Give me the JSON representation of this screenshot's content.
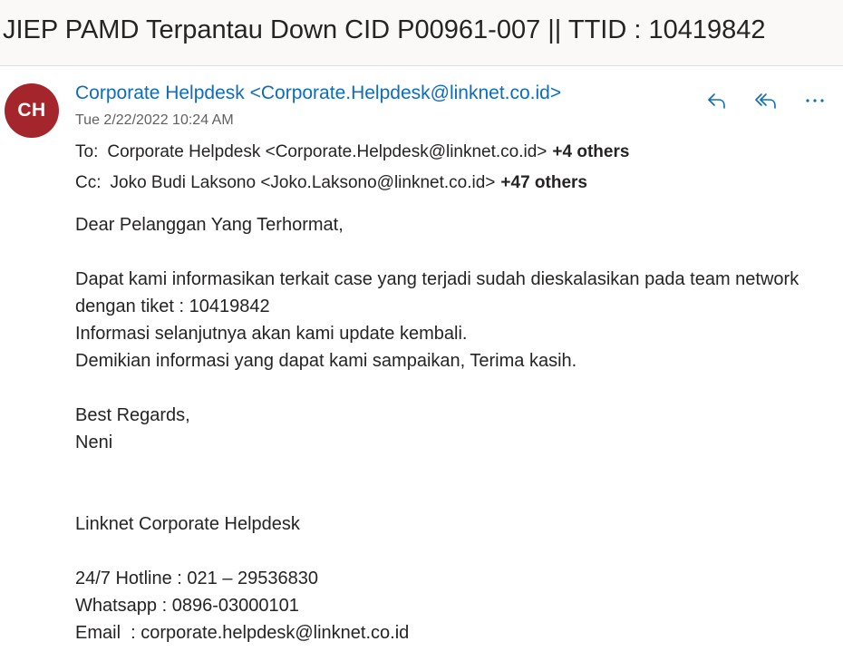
{
  "subject": "JIEP PAMD Terpantau Down CID P00961-007 || TTID : 10419842",
  "sender": {
    "initials": "CH",
    "display": "Corporate Helpdesk <Corporate.Helpdesk@linknet.co.id>",
    "date": "Tue 2/22/2022 10:24 AM",
    "avatar_color": "#a4262c",
    "name_color": "#0f6cbd"
  },
  "recipients": {
    "to_label": "To:",
    "to_value": "Corporate Helpdesk <Corporate.Helpdesk@linknet.co.id>",
    "to_more": "+4 others",
    "cc_label": "Cc:",
    "cc_value": "Joko Budi Laksono <Joko.Laksono@linknet.co.id>",
    "cc_more": "+47 others"
  },
  "actions": {
    "reply_icon": "reply-icon",
    "reply_all_icon": "reply-all-icon",
    "more_icon": "more-options-icon"
  },
  "body": {
    "greeting": "Dear Pelanggan Yang Terhormat,",
    "line1": "Dapat kami informasikan terkait case yang terjadi sudah dieskalasikan pada team network dengan tiket : 10419842",
    "line2": "Informasi selanjutnya akan kami update kembali.",
    "line3": "Demikian informasi yang dapat kami sampaikan, Terima kasih.",
    "regards": "Best Regards,",
    "name": "Neni",
    "company": "Linknet Corporate Helpdesk",
    "hotline": "24/7 Hotline : 021 – 29536830",
    "whatsapp": "Whatsapp : 0896-03000101",
    "email": "Email  : corporate.helpdesk@linknet.co.id"
  }
}
